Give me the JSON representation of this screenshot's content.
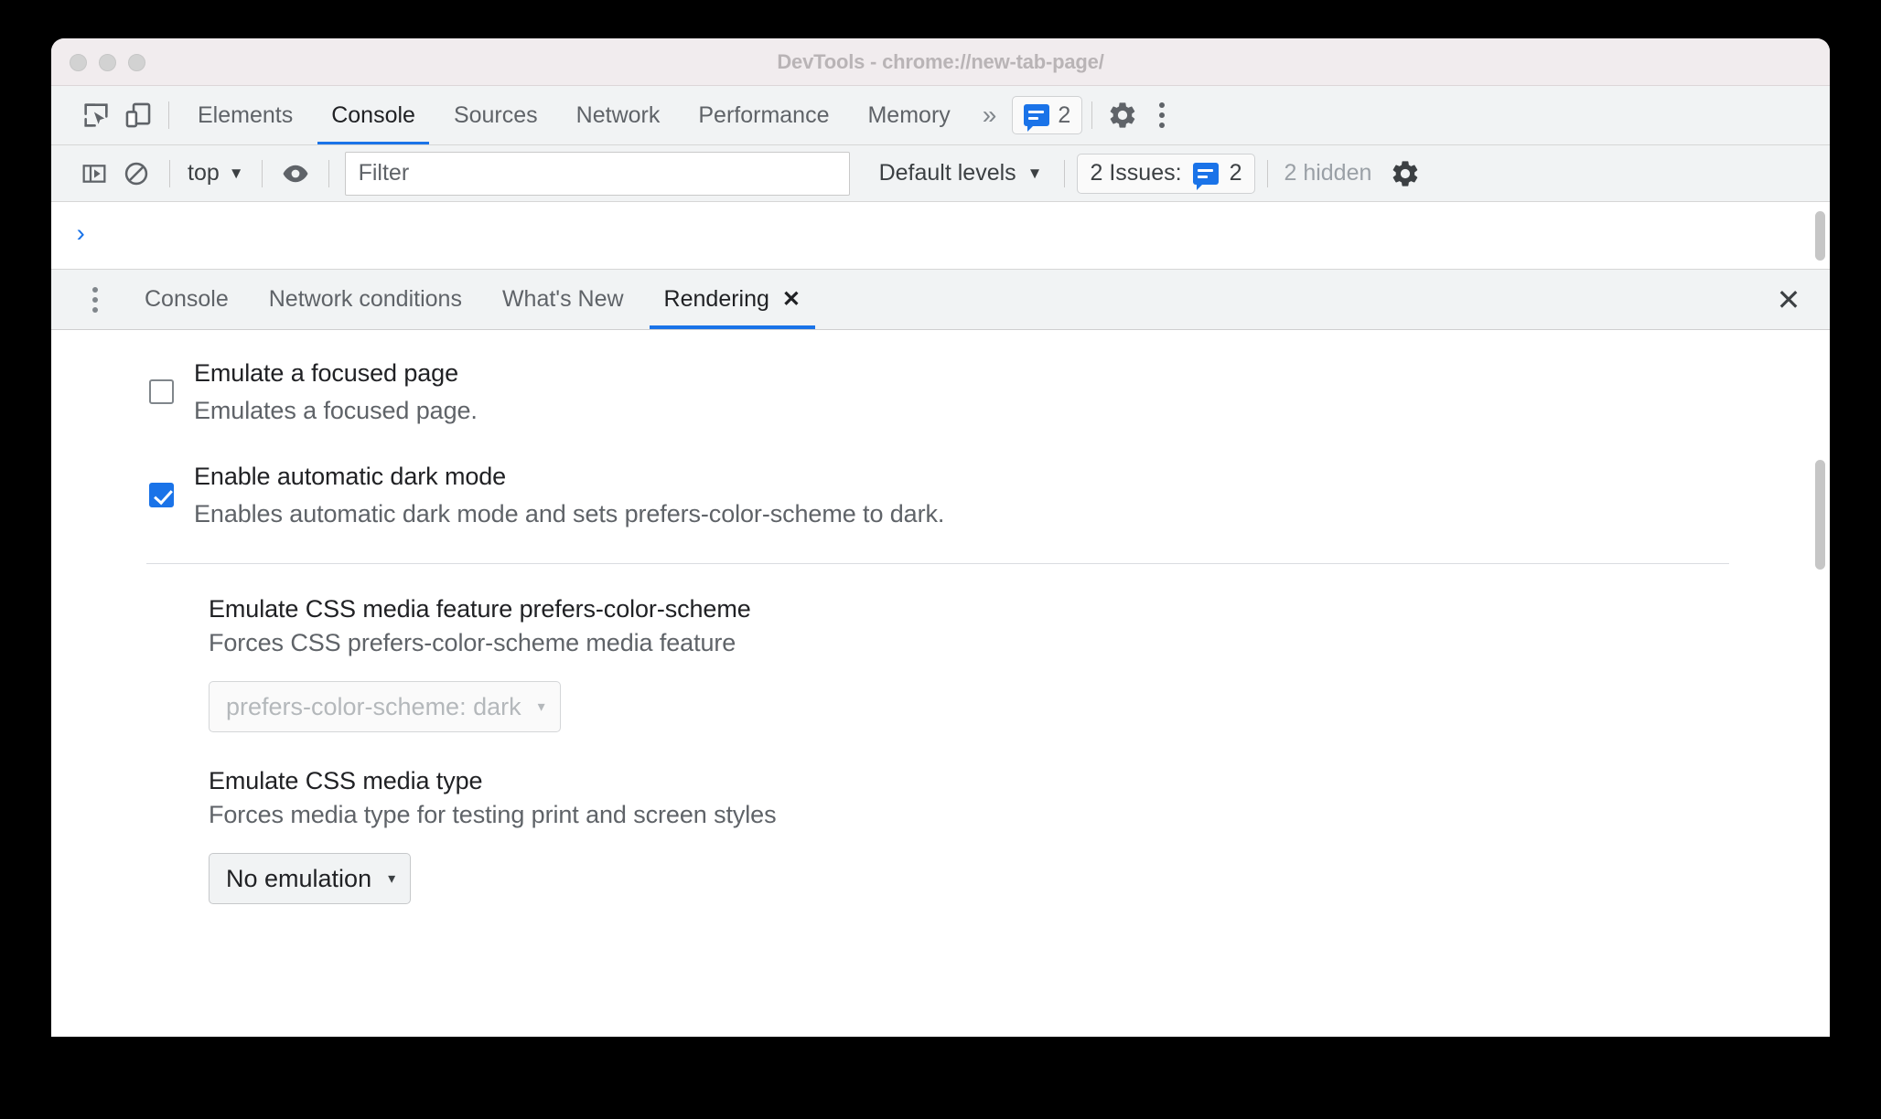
{
  "window": {
    "title": "DevTools - chrome://new-tab-page/",
    "traffic_lights": [
      "close",
      "minimize",
      "zoom"
    ]
  },
  "main_toolbar": {
    "inspect_icon": "inspect-element-icon",
    "device_icon": "device-toolbar-icon",
    "tabs": [
      {
        "label": "Elements",
        "active": false
      },
      {
        "label": "Console",
        "active": true
      },
      {
        "label": "Sources",
        "active": false
      },
      {
        "label": "Network",
        "active": false
      },
      {
        "label": "Performance",
        "active": false
      },
      {
        "label": "Memory",
        "active": false
      }
    ],
    "more_tabs": "»",
    "issues_count": "2",
    "settings_icon": "gear-icon",
    "menu_icon": "kebab-menu-icon"
  },
  "console_toolbar": {
    "sidebar_icon": "console-sidebar-icon",
    "clear_icon": "clear-console-icon",
    "context": "top",
    "caret": "▼",
    "eye_icon": "live-expression-icon",
    "filter_placeholder": "Filter",
    "filter_value": "",
    "levels": "Default levels",
    "issues_label": "2 Issues:",
    "issues_count": "2",
    "hidden_label": "2 hidden",
    "settings_icon": "gear-icon"
  },
  "console_prompt": {
    "caret": "›"
  },
  "drawer": {
    "menu_icon": "kebab-menu-icon",
    "tabs": [
      {
        "label": "Console",
        "active": false,
        "closable": false
      },
      {
        "label": "Network conditions",
        "active": false,
        "closable": false
      },
      {
        "label": "What's New",
        "active": false,
        "closable": false
      },
      {
        "label": "Rendering",
        "active": true,
        "closable": true,
        "close_glyph": "✕"
      }
    ],
    "close_glyph": "✕"
  },
  "rendering": {
    "settings": [
      {
        "title": "Emulate a focused page",
        "desc": "Emulates a focused page.",
        "checked": false
      },
      {
        "title": "Enable automatic dark mode",
        "desc": "Enables automatic dark mode and sets prefers-color-scheme to dark.",
        "checked": true
      }
    ],
    "blocks": [
      {
        "title": "Emulate CSS media feature prefers-color-scheme",
        "desc": "Forces CSS prefers-color-scheme media feature",
        "dropdown_value": "prefers-color-scheme: dark",
        "dropdown_disabled": true,
        "caret": "▾"
      },
      {
        "title": "Emulate CSS media type",
        "desc": "Forces media type for testing print and screen styles",
        "dropdown_value": "No emulation",
        "dropdown_disabled": false,
        "caret": "▾"
      }
    ]
  },
  "colors": {
    "accent": "#1a73e8",
    "toolbar_bg": "#f1f3f4",
    "titlebar_bg": "#f1ecee",
    "text_primary": "#202124",
    "text_secondary": "#5f6368",
    "text_disabled": "#b4b8bb"
  }
}
